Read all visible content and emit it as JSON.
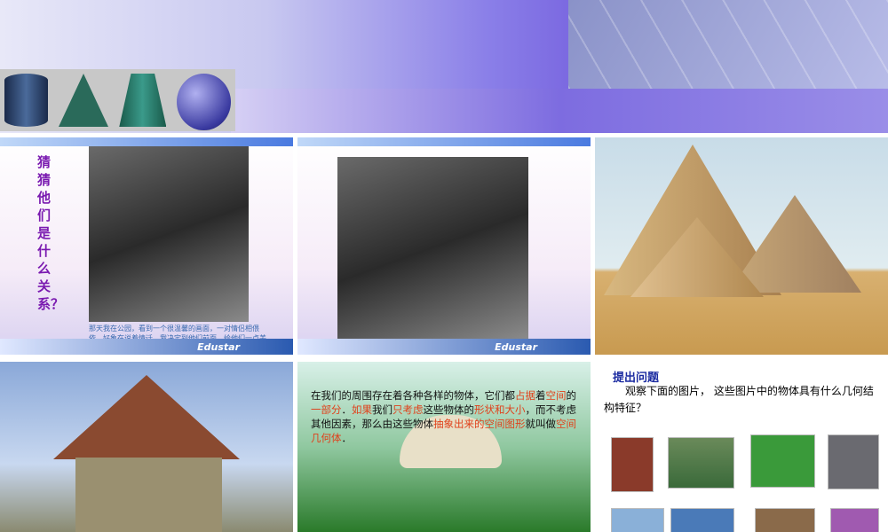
{
  "slide2": {
    "vertical_title": "猜猜他们是什么关系？",
    "caption": "那天我在公园，看到一个很温馨的画面，一对情侣相偎依，好象在说着情话，我决定到他们前面，给他们一点美好的祝福...",
    "logo": "Edustar"
  },
  "slide3": {
    "logo": "Edustar"
  },
  "slide6": {
    "parts": [
      {
        "t": "在我们的周围存在着各种各样的物体，它们都",
        "r": false
      },
      {
        "t": "占据",
        "r": true
      },
      {
        "t": "着",
        "r": false
      },
      {
        "t": "空间",
        "r": true
      },
      {
        "t": "的",
        "r": false
      },
      {
        "t": "一部分",
        "r": true
      },
      {
        "t": "．",
        "r": false
      },
      {
        "t": "如果",
        "r": true
      },
      {
        "t": "我们",
        "r": false
      },
      {
        "t": "只考虑",
        "r": true
      },
      {
        "t": "这些物体的",
        "r": false
      },
      {
        "t": "形状和大小",
        "r": true
      },
      {
        "t": "，而不考虑其他因素，那么由这些物体",
        "r": false
      },
      {
        "t": "抽象出来的空间图形",
        "r": true
      },
      {
        "t": "就叫做",
        "r": false
      },
      {
        "t": "空间几何体",
        "r": true
      },
      {
        "t": "．",
        "r": false
      }
    ]
  },
  "slide7": {
    "title": "提出问题",
    "text": "观察下面的图片， 这些图片中的物体具有什么几何结构特征？"
  }
}
